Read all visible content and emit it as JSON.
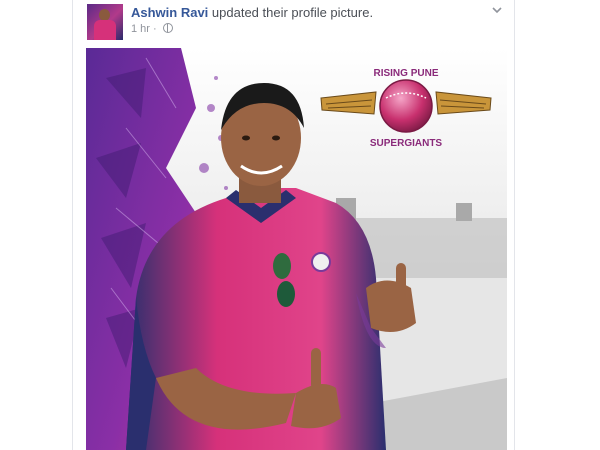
{
  "post": {
    "author_name": "Ashwin Ravi",
    "action_text": " updated their profile picture.",
    "timestamp": "1 hr",
    "separator": " · ",
    "privacy_icon": "globe-icon",
    "menu_icon": "chevron-down-icon"
  },
  "photo": {
    "logo_top": "RISING PUNE",
    "logo_bottom": "SUPERGIANTS"
  },
  "colors": {
    "link": "#365899",
    "jersey_pink": "#d6317a",
    "jersey_navy": "#2a2f6e",
    "purple": "#6b2a9a"
  }
}
